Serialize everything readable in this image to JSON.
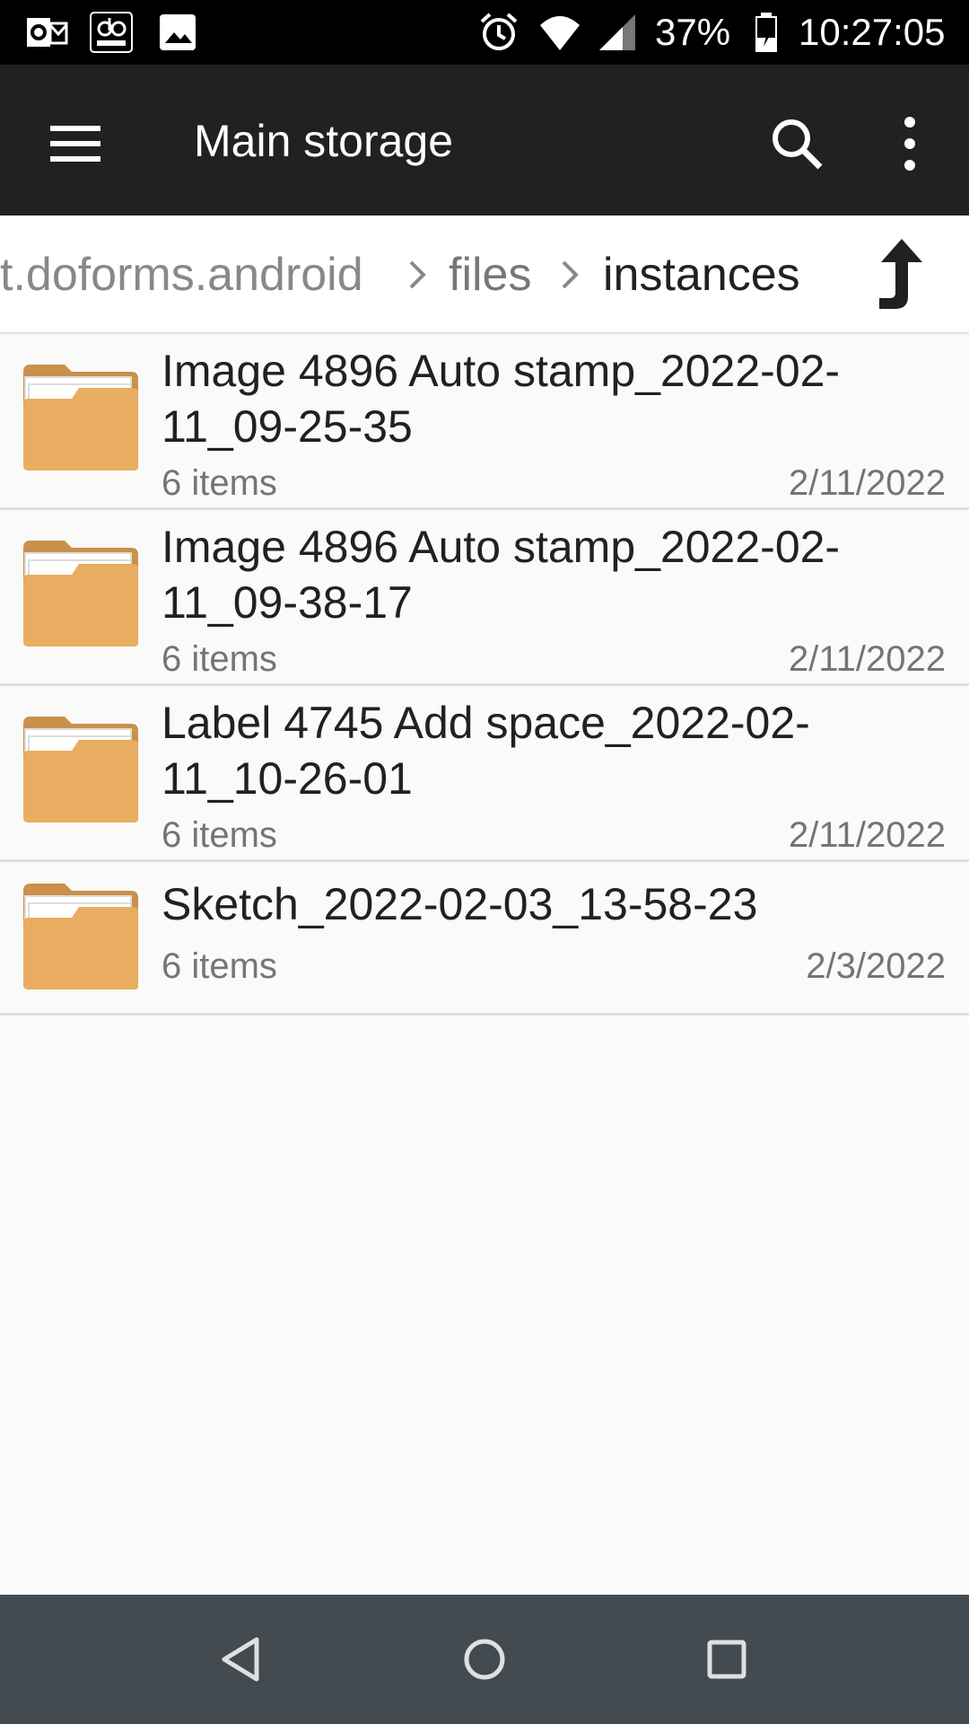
{
  "status_bar": {
    "battery_percent": "37%",
    "time": "10:27:05",
    "notification_icons": [
      "outlook-icon",
      "doforms-icon",
      "image-icon"
    ],
    "system_icons": [
      "alarm-icon",
      "wifi-icon",
      "cell-signal-icon",
      "battery-charging-icon"
    ]
  },
  "app_bar": {
    "title": "Main storage",
    "menu_icon": "hamburger-menu-icon",
    "search_icon": "search-icon",
    "more_icon": "more-vert-icon"
  },
  "breadcrumb": {
    "items": [
      "t.doforms.android",
      "files",
      "instances"
    ],
    "up_icon": "arrow-up-icon"
  },
  "files": [
    {
      "name": "Image 4896 Auto stamp_2022-02-11_09-25-35",
      "count": "6 items",
      "date": "2/11/2022"
    },
    {
      "name": "Image 4896 Auto stamp_2022-02-11_09-38-17",
      "count": "6 items",
      "date": "2/11/2022"
    },
    {
      "name": "Label 4745 Add space_2022-02-11_10-26-01",
      "count": "6 items",
      "date": "2/11/2022"
    },
    {
      "name": "Sketch_2022-02-03_13-58-23",
      "count": "6 items",
      "date": "2/3/2022"
    }
  ],
  "nav_bar": {
    "back_icon": "back-icon",
    "home_icon": "home-icon",
    "recents_icon": "recents-icon"
  },
  "colors": {
    "status_bar": "#000000",
    "app_bar": "#212121",
    "folder": "#e8ad60",
    "nav_bar": "#434a50",
    "background": "#fafafa"
  }
}
